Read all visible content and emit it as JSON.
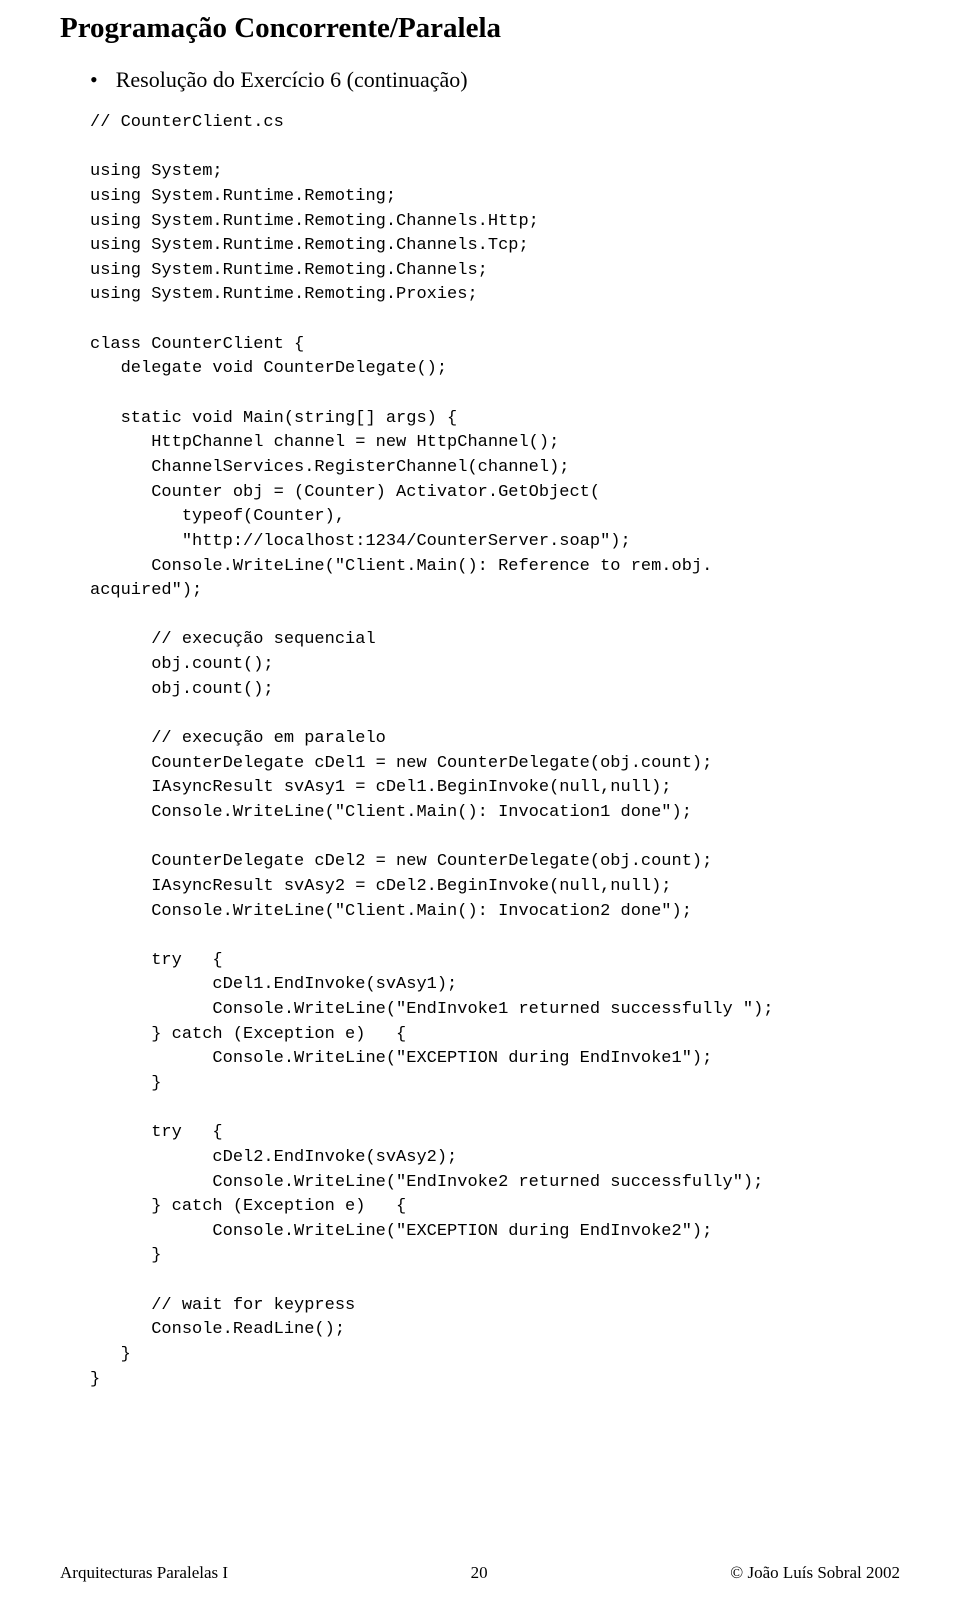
{
  "title": "Programação Concorrente/Paralela",
  "bullet": "Resolução do Exercício 6 (continuação)",
  "code": "// CounterClient.cs\n\nusing System;\nusing System.Runtime.Remoting;\nusing System.Runtime.Remoting.Channels.Http;\nusing System.Runtime.Remoting.Channels.Tcp;\nusing System.Runtime.Remoting.Channels;\nusing System.Runtime.Remoting.Proxies;\n\nclass CounterClient {\n   delegate void CounterDelegate();\n\n   static void Main(string[] args) {\n      HttpChannel channel = new HttpChannel();\n      ChannelServices.RegisterChannel(channel);\n      Counter obj = (Counter) Activator.GetObject(\n         typeof(Counter),\n         \"http://localhost:1234/CounterServer.soap\");\n      Console.WriteLine(\"Client.Main(): Reference to rem.obj.\nacquired\");\n\n      // execução sequencial\n      obj.count();\n      obj.count();\n\n      // execução em paralelo\n      CounterDelegate cDel1 = new CounterDelegate(obj.count);\n      IAsyncResult svAsy1 = cDel1.BeginInvoke(null,null);\n      Console.WriteLine(\"Client.Main(): Invocation1 done\");\n\n      CounterDelegate cDel2 = new CounterDelegate(obj.count);\n      IAsyncResult svAsy2 = cDel2.BeginInvoke(null,null);\n      Console.WriteLine(\"Client.Main(): Invocation2 done\");\n\n      try   {\n            cDel1.EndInvoke(svAsy1);\n            Console.WriteLine(\"EndInvoke1 returned successfully \");\n      } catch (Exception e)   {\n            Console.WriteLine(\"EXCEPTION during EndInvoke1\");\n      }\n\n      try   {\n            cDel2.EndInvoke(svAsy2);\n            Console.WriteLine(\"EndInvoke2 returned successfully\");\n      } catch (Exception e)   {\n            Console.WriteLine(\"EXCEPTION during EndInvoke2\");\n      }\n\n      // wait for keypress\n      Console.ReadLine();\n   }\n}",
  "footer": {
    "left": "Arquitecturas Paralelas I",
    "center": "20",
    "right": "© João Luís Sobral 2002"
  }
}
